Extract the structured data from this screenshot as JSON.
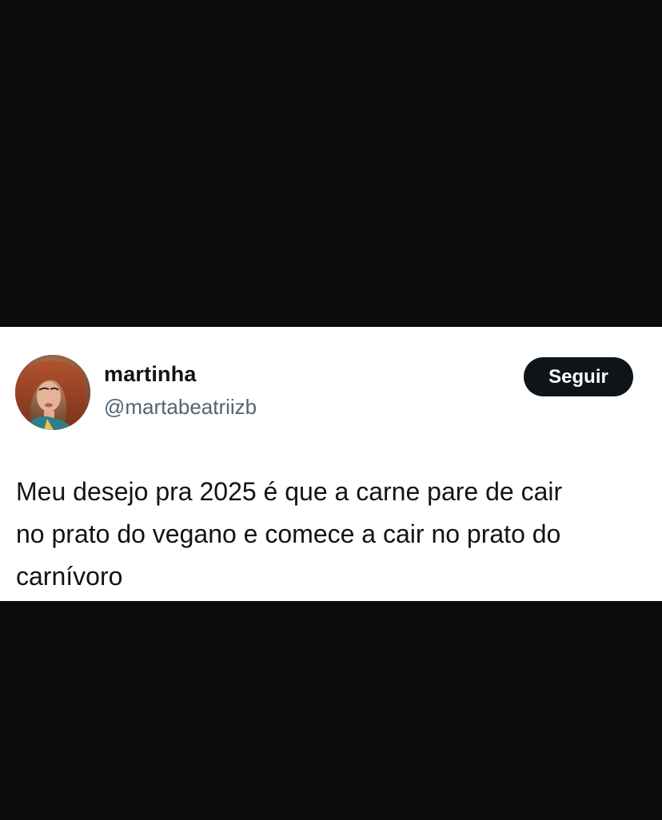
{
  "tweet": {
    "author": {
      "display_name": "martinha",
      "handle": "@martabeatriizb",
      "avatar_icon": "profile-photo"
    },
    "follow_button_label": "Seguir",
    "text_lines": [
      "Meu desejo pra 2025 é que a carne pare de cair",
      "no prato do vegano e comece a cair no prato do",
      "carnívoro"
    ]
  },
  "colors": {
    "background": "#0b0b0c",
    "card": "#ffffff",
    "primary_text": "#0f1419",
    "secondary_text": "#536471",
    "button_bg": "#0f1419",
    "button_text": "#ffffff"
  }
}
